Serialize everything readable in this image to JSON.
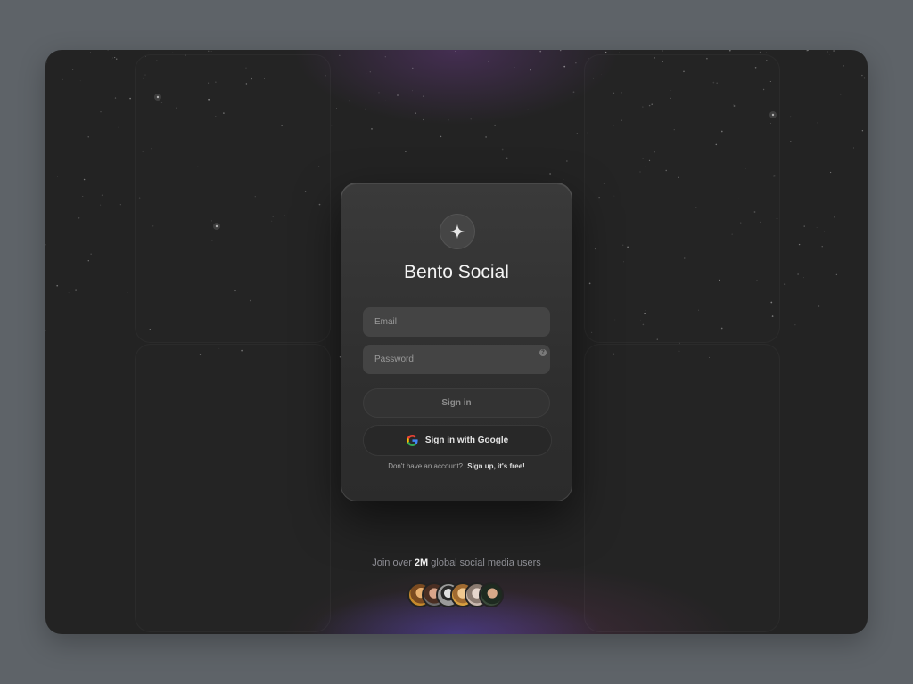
{
  "app": {
    "title": "Bento Social",
    "logo_icon": "sparkle-icon"
  },
  "form": {
    "email_placeholder": "Email",
    "password_placeholder": "Password",
    "password_help_icon": "help-circle-icon",
    "signin_label": "Sign in",
    "google_label": "Sign in with Google",
    "google_icon": "google-icon",
    "no_account_text": "Don't have an account?",
    "signup_link": "Sign up, it's free!"
  },
  "footer": {
    "join_prefix": "Join over",
    "join_count": "2M",
    "join_suffix": "global social media users",
    "avatar_count": 6
  },
  "colors": {
    "background": "#5e6368",
    "frame": "#232323",
    "card": "#353535",
    "accent_glow": "#5046b4"
  }
}
